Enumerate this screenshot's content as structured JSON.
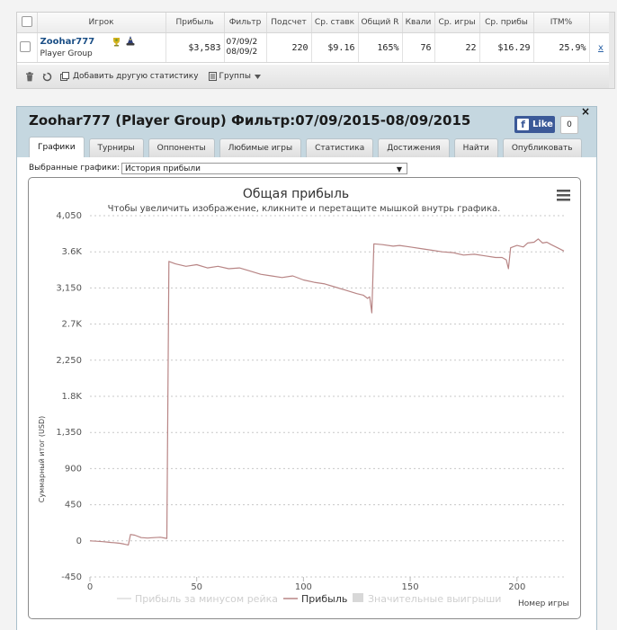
{
  "stats_table": {
    "headers": [
      "Игрок",
      "Прибыль",
      "Фильтр",
      "Подсчет",
      "Ср. ставк",
      "Общий R",
      "Квали",
      "Ср. игры",
      "Ср. прибы",
      "ITM%"
    ],
    "row": {
      "player": "Zoohar777",
      "group": "Player Group",
      "profit": "$3,583",
      "filter_from": "07/09/2",
      "filter_to": "08/09/2",
      "count": "220",
      "avg_stake": "$9.16",
      "total_roi": "165%",
      "quali": "76",
      "avg_games": "22",
      "avg_profit": "$16.29",
      "itm": "25.9%",
      "remove": "x"
    },
    "toolbar": {
      "add_stats": "Добавить другую статистику",
      "groups": "Группы"
    }
  },
  "panel": {
    "title": "Zoohar777 (Player Group) Фильтр:07/09/2015-08/09/2015",
    "fb_like": "Like",
    "fb_count": "0",
    "close": "×",
    "tabs": [
      "Графики",
      "Турниры",
      "Оппоненты",
      "Любимые игры",
      "Статистика",
      "Достижения",
      "Найти",
      "Опубликовать"
    ],
    "active_tab": "Графики",
    "select_label": "Выбранные графики:",
    "select_value": "История прибыли"
  },
  "chart_data": {
    "type": "line",
    "title": "Общая прибыль",
    "subtitle": "Чтобы увеличить изображение, кликните и перетащите мышкой внутрь графика.",
    "xlabel": "Номер игры",
    "ylabel": "Суммарный итог (USD)",
    "xlim": [
      0,
      222
    ],
    "ylim": [
      -450,
      4050
    ],
    "x_ticks": [
      "0",
      "50",
      "100",
      "150",
      "200"
    ],
    "y_ticks": [
      "-450",
      "0",
      "450",
      "900",
      "1,350",
      "1.8K",
      "2,250",
      "2.7K",
      "3,150",
      "3.6K",
      "4,050"
    ],
    "legend": [
      "Прибыль за минусом рейка",
      "Прибыль",
      "Значительные выигрыши"
    ],
    "legend_active": [
      false,
      true,
      false
    ],
    "series_color": "#b88585",
    "series": [
      {
        "name": "Прибыль",
        "points": [
          [
            0,
            0
          ],
          [
            3,
            -5
          ],
          [
            6,
            -10
          ],
          [
            8,
            -15
          ],
          [
            10,
            -20
          ],
          [
            12,
            -25
          ],
          [
            14,
            -30
          ],
          [
            16,
            -40
          ],
          [
            18,
            -52
          ],
          [
            19,
            80
          ],
          [
            21,
            70
          ],
          [
            24,
            40
          ],
          [
            27,
            35
          ],
          [
            30,
            40
          ],
          [
            33,
            45
          ],
          [
            36,
            30
          ],
          [
            37,
            3480
          ],
          [
            40,
            3450
          ],
          [
            45,
            3420
          ],
          [
            50,
            3440
          ],
          [
            55,
            3400
          ],
          [
            60,
            3420
          ],
          [
            65,
            3390
          ],
          [
            70,
            3400
          ],
          [
            75,
            3360
          ],
          [
            80,
            3320
          ],
          [
            85,
            3300
          ],
          [
            90,
            3280
          ],
          [
            95,
            3300
          ],
          [
            100,
            3250
          ],
          [
            105,
            3220
          ],
          [
            110,
            3200
          ],
          [
            115,
            3160
          ],
          [
            120,
            3120
          ],
          [
            125,
            3080
          ],
          [
            128,
            3060
          ],
          [
            130,
            3020
          ],
          [
            131,
            3040
          ],
          [
            132,
            2840
          ],
          [
            133,
            3700
          ],
          [
            137,
            3690
          ],
          [
            142,
            3670
          ],
          [
            145,
            3680
          ],
          [
            150,
            3660
          ],
          [
            155,
            3640
          ],
          [
            160,
            3620
          ],
          [
            165,
            3600
          ],
          [
            170,
            3590
          ],
          [
            175,
            3560
          ],
          [
            180,
            3570
          ],
          [
            185,
            3550
          ],
          [
            190,
            3530
          ],
          [
            193,
            3530
          ],
          [
            195,
            3500
          ],
          [
            196,
            3390
          ],
          [
            197,
            3650
          ],
          [
            200,
            3680
          ],
          [
            203,
            3660
          ],
          [
            205,
            3710
          ],
          [
            208,
            3720
          ],
          [
            210,
            3760
          ],
          [
            212,
            3710
          ],
          [
            214,
            3720
          ],
          [
            216,
            3690
          ],
          [
            219,
            3650
          ],
          [
            222,
            3610
          ]
        ]
      }
    ]
  }
}
